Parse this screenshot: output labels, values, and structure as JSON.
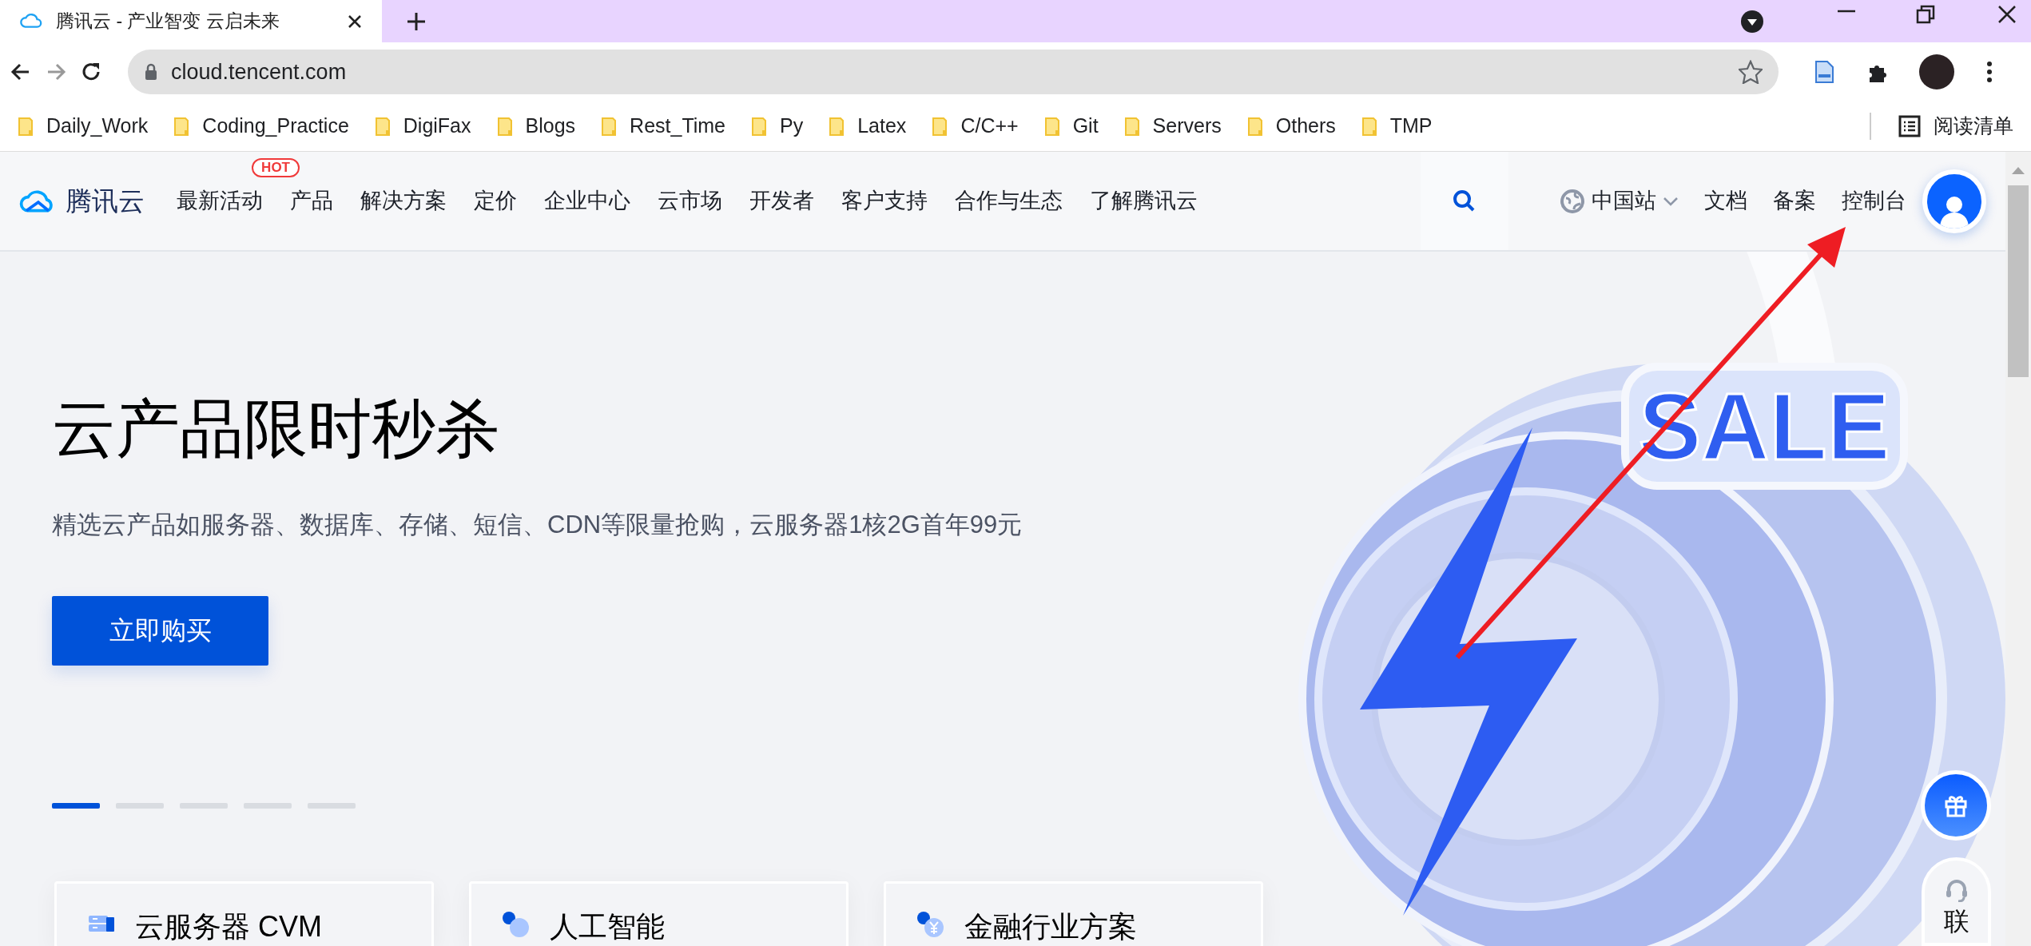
{
  "browser": {
    "tab": {
      "title": "腾讯云 - 产业智变 云启未来",
      "selected": true
    },
    "address": {
      "url": "cloud.tencent.com"
    },
    "bookmarks": [
      {
        "label": "Daily_Work"
      },
      {
        "label": "Coding_Practice"
      },
      {
        "label": "DigiFax"
      },
      {
        "label": "Blogs"
      },
      {
        "label": "Rest_Time"
      },
      {
        "label": "Py"
      },
      {
        "label": "Latex"
      },
      {
        "label": "C/C++"
      },
      {
        "label": "Git"
      },
      {
        "label": "Servers"
      },
      {
        "label": "Others"
      },
      {
        "label": "TMP"
      }
    ],
    "reading_list": "阅读清单"
  },
  "site_nav": {
    "logo_text": "腾讯云",
    "items": [
      {
        "label": "最新活动",
        "badge": "HOT"
      },
      {
        "label": "产品"
      },
      {
        "label": "解决方案"
      },
      {
        "label": "定价"
      },
      {
        "label": "企业中心"
      },
      {
        "label": "云市场"
      },
      {
        "label": "开发者"
      },
      {
        "label": "客户支持"
      },
      {
        "label": "合作与生态"
      },
      {
        "label": "了解腾讯云"
      }
    ],
    "region": "中国站",
    "links": [
      {
        "label": "文档"
      },
      {
        "label": "备案"
      },
      {
        "label": "控制台"
      }
    ]
  },
  "hero": {
    "title": "云产品限时秒杀",
    "subtitle": "精选云产品如服务器、数据库、存储、短信、CDN等限量抢购，云服务器1核2G首年99元",
    "button": "立即购买",
    "slide_dots": [
      {
        "selected": true
      },
      {
        "selected": false
      },
      {
        "selected": false
      },
      {
        "selected": false
      },
      {
        "selected": false
      }
    ],
    "illustration_text": "SALE"
  },
  "cards": [
    {
      "kind": "server",
      "title": "云服务器 CVM"
    },
    {
      "kind": "ai",
      "title": "人工智能"
    },
    {
      "kind": "finance",
      "title": "金融行业方案"
    }
  ],
  "float_contact": "联"
}
